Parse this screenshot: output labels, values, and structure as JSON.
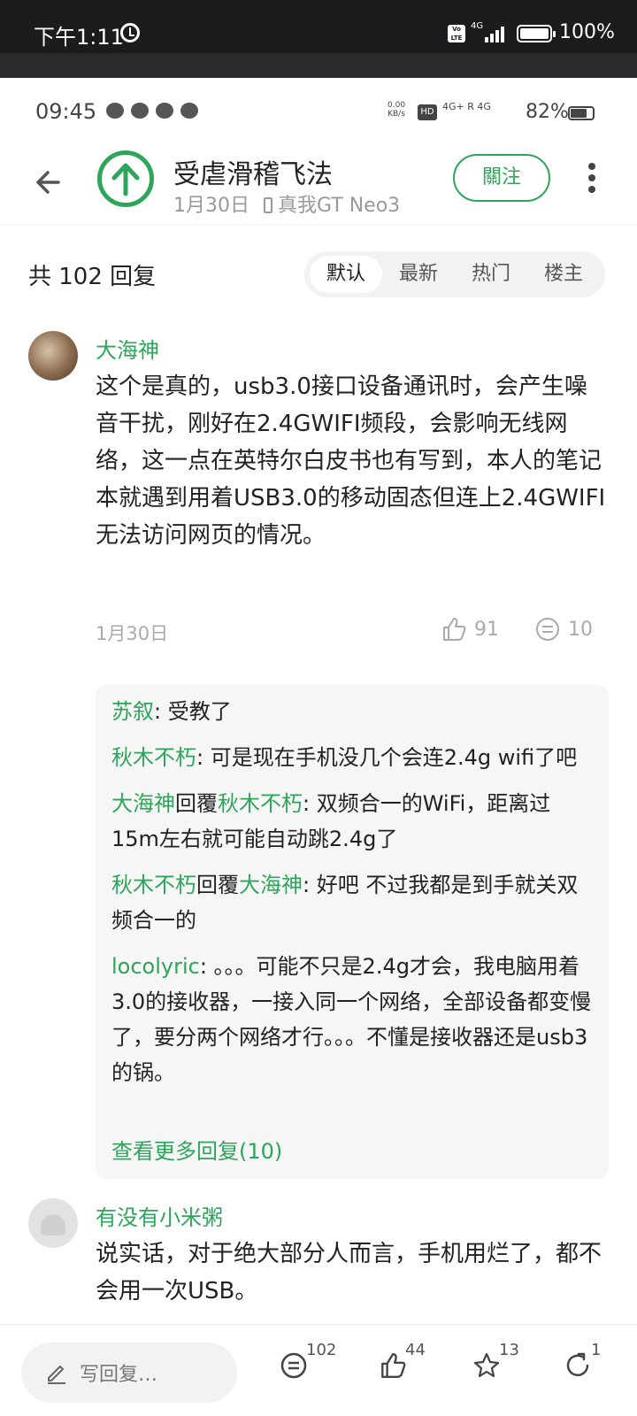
{
  "system_status": {
    "time": "下午1:11",
    "network": "4G",
    "battery_pct": "100%"
  },
  "inner_status": {
    "time": "09:45",
    "speed_value": "0.00",
    "speed_unit": "KB/s",
    "hd": "HD",
    "signal_label": "4G+ R 4G",
    "battery_pct": "82%"
  },
  "post": {
    "author": "受虐滑稽飞法",
    "date": "1月30日",
    "device": "真我GT Neo3",
    "follow_label": "關注"
  },
  "replies_header": {
    "count_label": "共 102 回复",
    "tabs": [
      "默认",
      "最新",
      "热门",
      "楼主"
    ],
    "active_tab": "默认"
  },
  "comments": [
    {
      "user": "大海神",
      "text": "这个是真的，usb3.0接口设备通讯时，会产生噪音干扰，刚好在2.4GWIFI频段，会影响无线网络，这一点在英特尔白皮书也有写到，本人的笔记本就遇到用着USB3.0的移动固态但连上2.4GWIFI无法访问网页的情况。",
      "date": "1月30日",
      "likes": "91",
      "replies": "10",
      "sub_replies": [
        {
          "user": "苏叙",
          "reply_to": "",
          "text": ": 受教了"
        },
        {
          "user": "秋木不朽",
          "reply_to": "",
          "text": ": 可是现在手机没几个会连2.4g wifi了吧"
        },
        {
          "user": "大海神",
          "mid": "回覆",
          "reply_to": "秋木不朽",
          "text": ": 双频合一的WiFi，距离过15m左右就可能自动跳2.4g了"
        },
        {
          "user": "秋木不朽",
          "mid": "回覆",
          "reply_to": "大海神",
          "text": ": 好吧 不过我都是到手就关双频合一的"
        },
        {
          "user": "locolyric",
          "reply_to": "",
          "text": ": 。。。可能不只是2.4g才会，我电脑用着3.0的接收器，一接入同一个网络，全部设备都变慢了，要分两个网络才行。。。不懂是接收器还是usb3的锅。"
        }
      ],
      "more_replies_label": "查看更多回复(10)"
    },
    {
      "user": "有没有小米粥",
      "text": "说实话，对于绝大部分人而言，手机用烂了，都不会用一次USB。"
    }
  ],
  "bottom_bar": {
    "reply_placeholder": "写回复…",
    "comments_count": "102",
    "likes_count": "44",
    "favorites_count": "13",
    "shares_count": "1"
  },
  "colors": {
    "accent": "#2ea55a",
    "sub_bg": "#f6f6f6"
  }
}
